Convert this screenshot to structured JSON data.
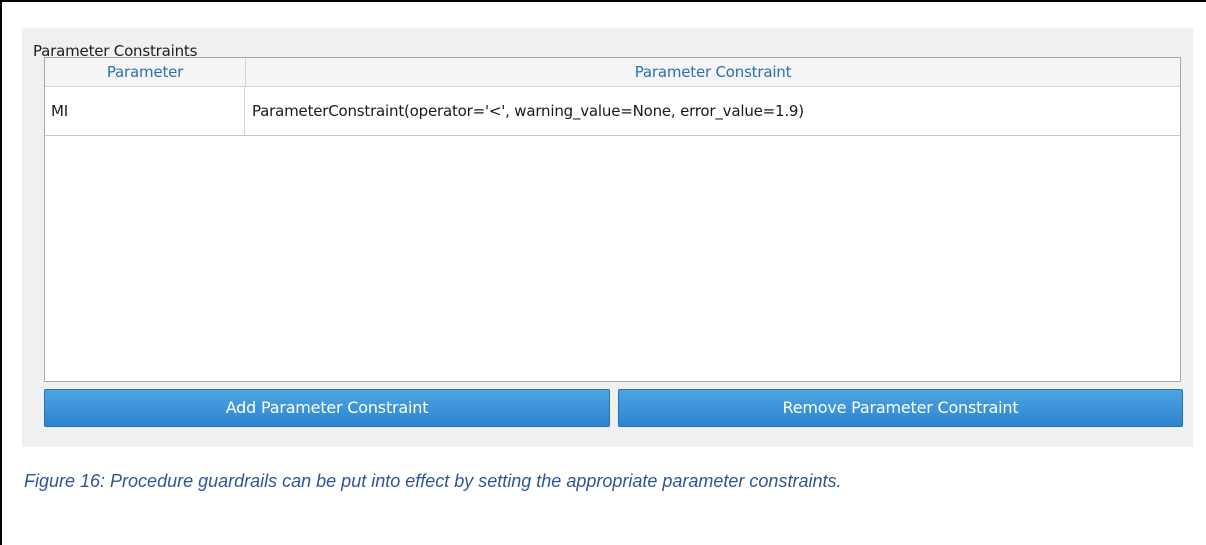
{
  "group": {
    "title": "Parameter Constraints"
  },
  "table": {
    "headers": [
      "Parameter",
      "Parameter Constraint"
    ],
    "rows": [
      [
        "MI",
        "ParameterConstraint(operator='<', warning_value=None, error_value=1.9)"
      ]
    ]
  },
  "buttons": {
    "add": "Add Parameter Constraint",
    "remove": "Remove Parameter Constraint"
  },
  "caption": "Figure 16: Procedure guardrails can be put into effect by setting the appropriate parameter constraints.",
  "colors": {
    "header_text": "#2a6fb0",
    "button_bg": "#2a85cf",
    "caption_text": "#2f5597"
  }
}
